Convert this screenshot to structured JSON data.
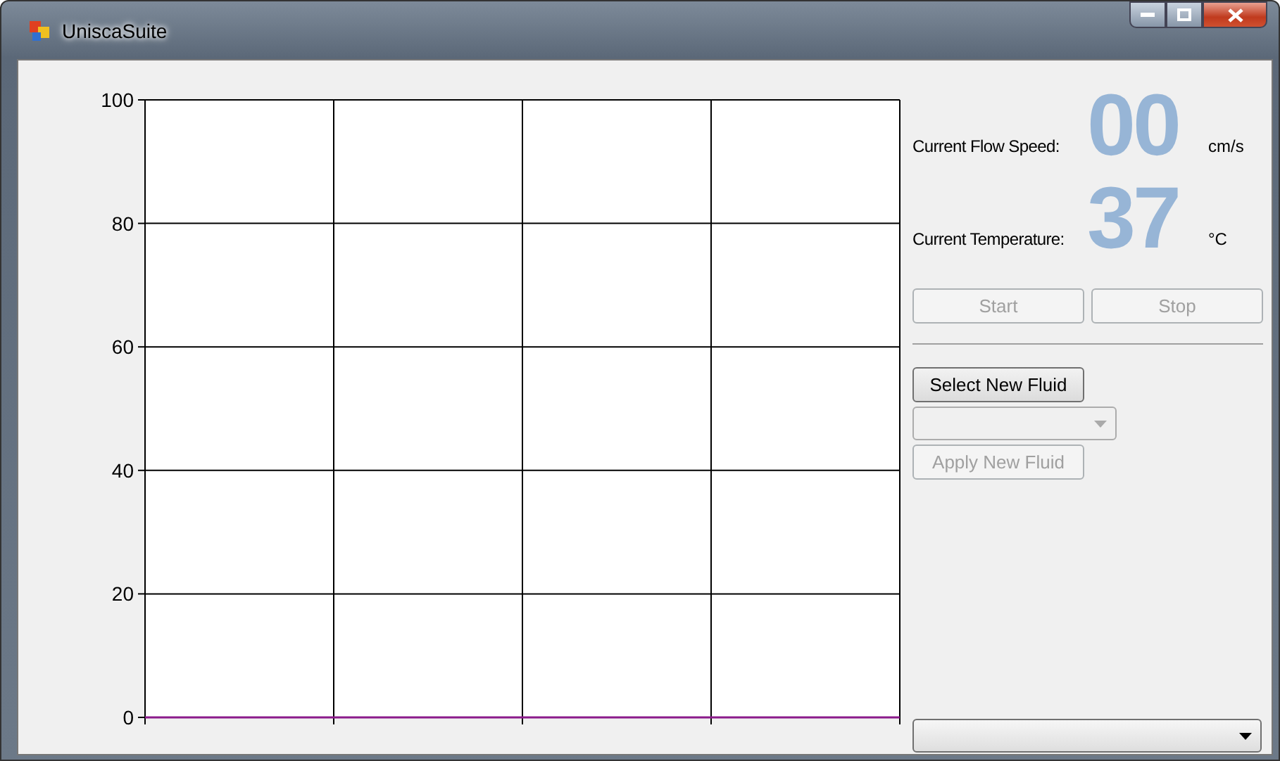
{
  "window": {
    "title": "UniscaSuite"
  },
  "chart": {
    "chart_data": {
      "type": "line",
      "ylim": [
        0,
        100
      ],
      "yticks": [
        0,
        20,
        40,
        60,
        80,
        100
      ],
      "grid": true,
      "series": [
        {
          "color": "#8b1a8b",
          "values": [
            0,
            0,
            0,
            0,
            0
          ]
        }
      ]
    }
  },
  "readouts": [
    {
      "label": "Current Flow Speed:",
      "value": "00",
      "unit": "cm/s"
    },
    {
      "label": "Current Temperature:",
      "value": "37",
      "unit": "°C"
    }
  ],
  "run_buttons": [
    {
      "label": "Start",
      "disabled": true
    },
    {
      "label": "Stop",
      "disabled": true
    }
  ],
  "fluid": {
    "select_button": {
      "label": "Select New Fluid",
      "disabled": false
    },
    "dropdown": {
      "disabled": true
    },
    "apply_button": {
      "label": "Apply New Fluid",
      "disabled": true
    }
  },
  "bottom_dropdown": {
    "disabled": false
  }
}
